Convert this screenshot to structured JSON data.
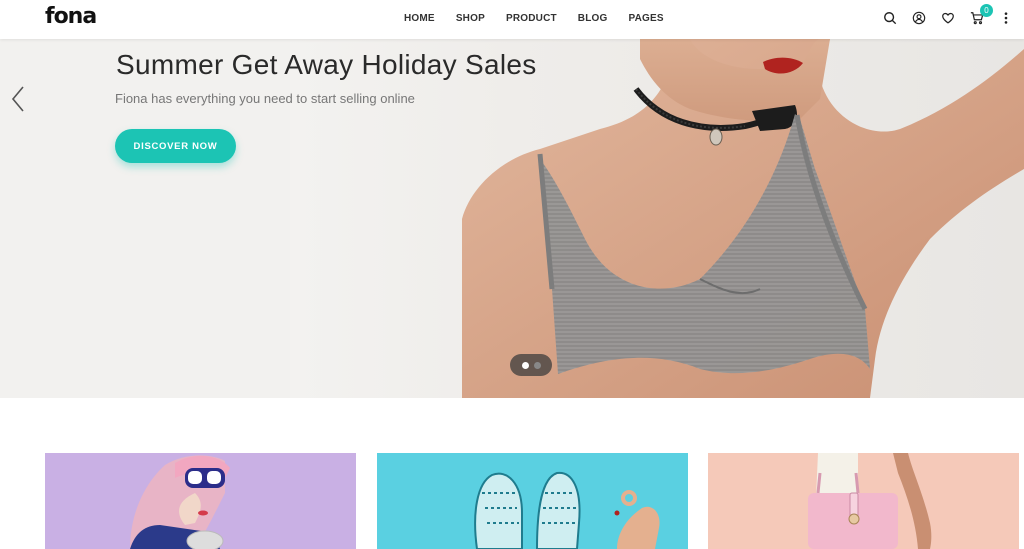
{
  "brand": {
    "logo": "fona"
  },
  "nav": {
    "items": [
      "HOME",
      "SHOP",
      "PRODUCT",
      "BLOG",
      "PAGES"
    ]
  },
  "header_icons": {
    "search": "search-icon",
    "account": "user-icon",
    "wishlist": "heart-icon",
    "cart": "cart-icon",
    "cart_count": "0",
    "more": "more-vertical-icon"
  },
  "hero": {
    "title": "Summer Get Away Holiday Sales",
    "subtitle": "Fiona has everything you need to start selling online",
    "cta": "DISCOVER NOW",
    "slides_total": 2,
    "active_slide": 1
  },
  "colors": {
    "accent": "#1cc4b4",
    "card1": "#c9b0e4",
    "card2": "#5ad0e1",
    "card3": "#f5c9b9"
  }
}
